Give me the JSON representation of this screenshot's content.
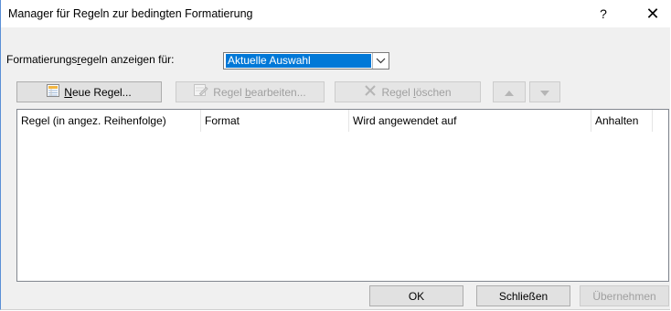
{
  "window": {
    "title": "Manager für Regeln zur bedingten Formatierung",
    "help_glyph": "?",
    "close_glyph": "✕"
  },
  "show_rules": {
    "label_pre": "Formatierungs",
    "label_u": "r",
    "label_post": "egeln anzeigen für:",
    "selected": "Aktuelle Auswahl"
  },
  "toolbar": {
    "new_pre": "",
    "new_u": "N",
    "new_post": "eue Regel...",
    "edit_pre": "Regel ",
    "edit_u": "b",
    "edit_post": "earbeiten...",
    "delete_pre": "Regel ",
    "delete_u": "l",
    "delete_post": "öschen"
  },
  "table": {
    "columns": [
      "Regel (in angez. Reihenfolge)",
      "Format",
      "Wird angewendet auf",
      "Anhalten"
    ],
    "rows": []
  },
  "buttons": {
    "ok": "OK",
    "close": "Schließen",
    "apply": "Übernehmen"
  },
  "colors": {
    "selection": "#0078d7",
    "dialog_bg": "#f0f0f0",
    "disabled_text": "#a0a0a0"
  }
}
